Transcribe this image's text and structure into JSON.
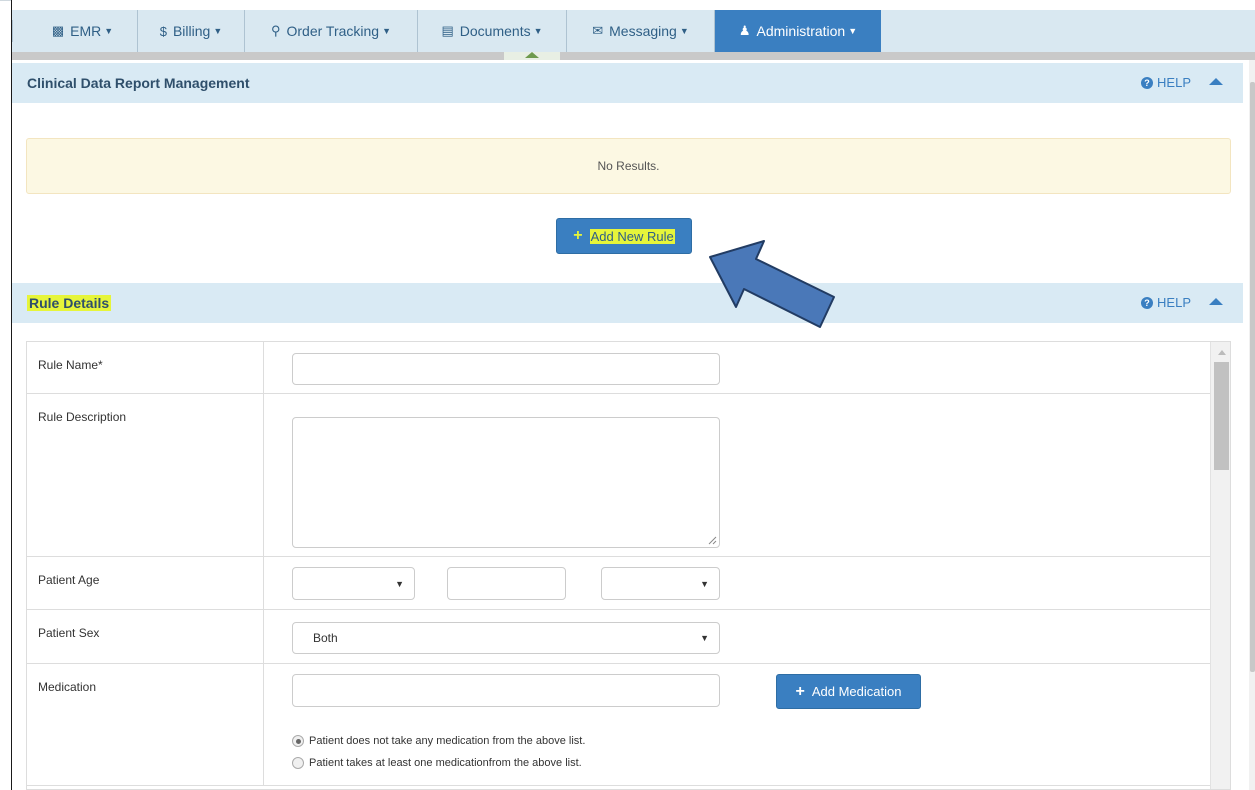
{
  "nav": {
    "items": [
      {
        "label": "EMR",
        "icon": "document-icon"
      },
      {
        "label": "Billing",
        "icon": "dollar-icon"
      },
      {
        "label": "Order Tracking",
        "icon": "search-icon"
      },
      {
        "label": "Documents",
        "icon": "file-icon"
      },
      {
        "label": "Messaging",
        "icon": "envelope-icon"
      },
      {
        "label": "Administration",
        "icon": "user-icon",
        "active": true
      }
    ]
  },
  "report_panel": {
    "title": "Clinical Data Report Management",
    "help": "HELP",
    "no_results": "No Results.",
    "add_rule_label": "Add New Rule"
  },
  "rule_panel": {
    "title": "Rule Details",
    "help": "HELP"
  },
  "form": {
    "rule_name_label": "Rule Name*",
    "rule_description_label": "Rule Description",
    "patient_age_label": "Patient Age",
    "patient_sex_label": "Patient Sex",
    "patient_sex_value": "Both",
    "medication_label": "Medication",
    "add_medication_label": "Add Medication",
    "radio_not_take": "Patient does not take any medication from the above list.",
    "radio_takes": "Patient takes at least one medicationfrom the above list."
  },
  "colors": {
    "accent": "#3a7fc1",
    "nav_bg": "#d9e8f1",
    "highlight": "#e6f53a",
    "arrow": "#4a78b8"
  }
}
